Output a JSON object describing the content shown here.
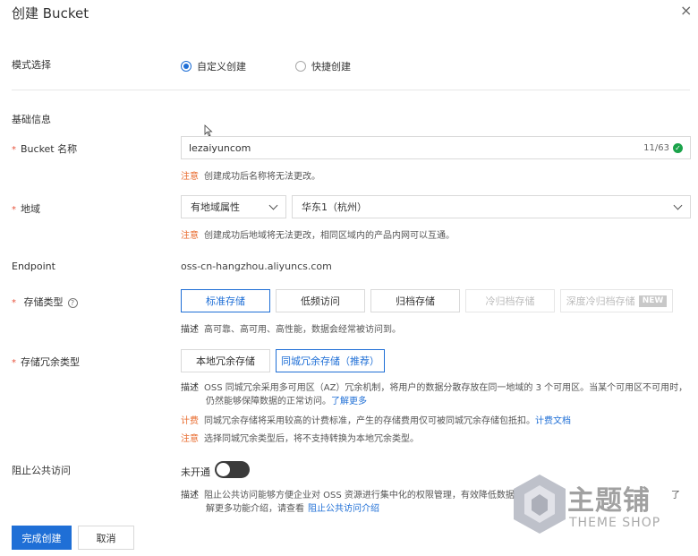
{
  "header": {
    "title": "创建 Bucket",
    "close_symbol": "×"
  },
  "mode": {
    "label": "模式选择",
    "options": [
      {
        "label": "自定义创建",
        "selected": true
      },
      {
        "label": "快捷创建",
        "selected": false
      }
    ]
  },
  "basic": {
    "section_title": "基础信息",
    "bucket_name": {
      "label": "Bucket 名称",
      "value": "lezaiyuncom",
      "counter": "11/63",
      "hint_tag": "注意",
      "hint_text": "创建成功后名称将无法更改。"
    },
    "region": {
      "label": "地域",
      "attr_select": "有地域属性",
      "region_select": "华东1（杭州）",
      "hint_tag": "注意",
      "hint_text": "创建成功后地域将无法更改，相同区域内的产品内网可以互通。"
    },
    "endpoint": {
      "label": "Endpoint",
      "value": "oss-cn-hangzhou.aliyuncs.com"
    },
    "storage_class": {
      "label": "存储类型",
      "help_symbol": "?",
      "options": [
        "标准存储",
        "低频访问",
        "归档存储",
        "冷归档存储",
        "深度冷归档存储"
      ],
      "new_badge": "NEW",
      "desc_tag": "描述",
      "desc_text": "高可靠、高可用、高性能，数据会经常被访问到。"
    },
    "redundancy": {
      "label": "存储冗余类型",
      "options": [
        "本地冗余存储",
        "同城冗余存储（推荐）"
      ],
      "desc_tag": "描述",
      "desc_text_1": "OSS 同城冗余采用多可用区（AZ）冗余机制，将用户的数据分散存放在同一地域的 3 个可用区。当某个可用区不可用时，",
      "desc_text_2": "仍然能够保障数据的正常访问。",
      "desc_link": "了解更多",
      "fee_tag": "计费",
      "fee_text": "同城冗余存储将采用较高的计费标准，产生的存储费用仅可被同城冗余存储包抵扣。",
      "fee_link": "计费文档",
      "note_tag": "注意",
      "note_text": "选择同城冗余类型后，将不支持转换为本地冗余类型。"
    },
    "public_access": {
      "label": "阻止公共访问",
      "toggle_text": "未开通",
      "desc_tag": "描述",
      "desc_text_1": "阻止公共访问能够方便企业对 OSS 资源进行集中化的权限管理，有效降低数据",
      "desc_text_1b": "了",
      "desc_text_2": "解更多功能介绍，请查看",
      "desc_link": "阻止公共访问介绍"
    }
  },
  "footer": {
    "confirm": "完成创建",
    "cancel": "取消"
  },
  "watermark": {
    "text": "主题铺",
    "sub": "THEME SHOP"
  },
  "colors": {
    "primary": "#1f6fd6",
    "orange": "#e86a2c",
    "success": "#1aa34a",
    "required": "#e8553e"
  }
}
